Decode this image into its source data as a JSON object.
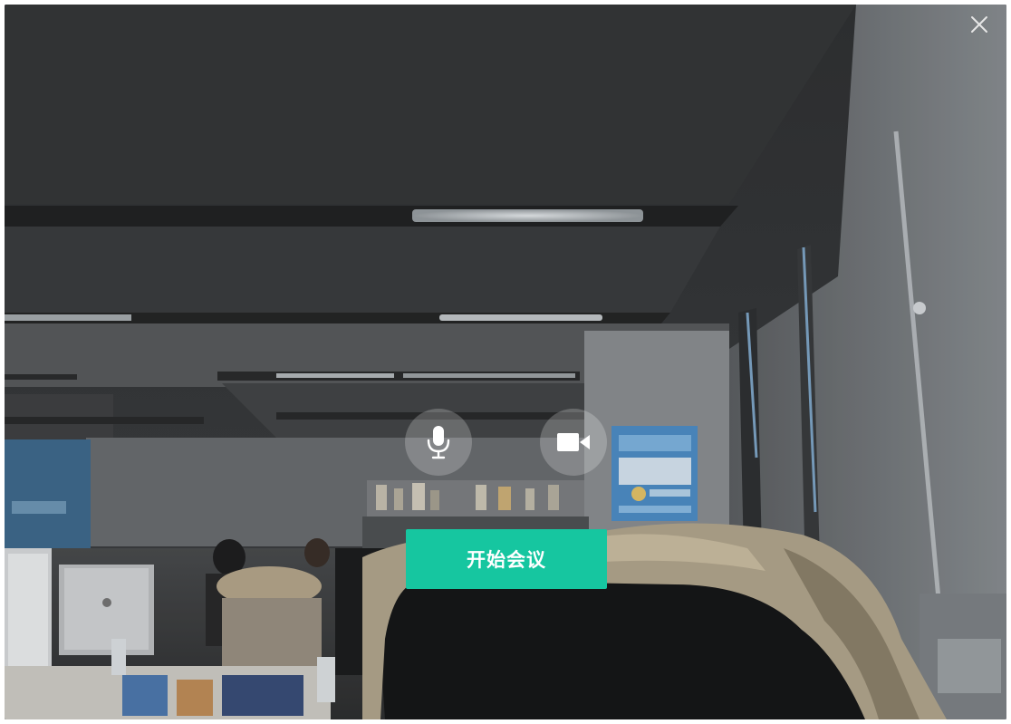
{
  "window": {
    "close_icon": "close-icon"
  },
  "preview": {
    "description_icon": "camera-preview"
  },
  "controls": {
    "mic_icon": "microphone-icon",
    "camera_icon": "video-camera-icon"
  },
  "start_meeting": {
    "label": "开始会议",
    "color": "#16c6a0"
  }
}
